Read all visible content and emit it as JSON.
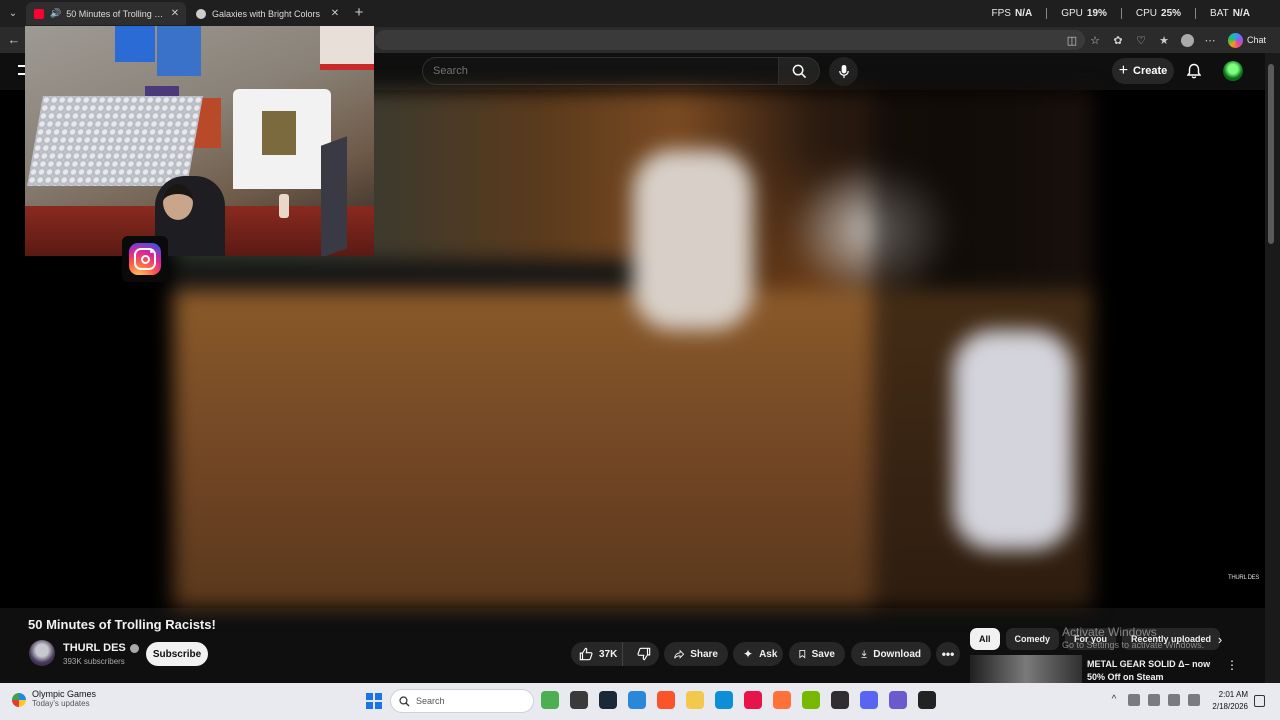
{
  "browser": {
    "tabs": [
      {
        "title": "50 Minutes of Trolling Racists!",
        "active": true,
        "favicon_color": "#ff0033"
      },
      {
        "title": "Galaxies with Bright Colors",
        "active": false,
        "favicon_color": "#cccccc"
      }
    ],
    "tab_close_glyph": "✕",
    "new_tab_glyph": "+",
    "back_glyph": "←",
    "chat_label": "Chat",
    "toolbar_icons": [
      "split-screen-icon",
      "favorite-star-icon",
      "extensions-icon",
      "performance-icon",
      "favorites-icon",
      "profile-icon",
      "more-icon"
    ]
  },
  "performance_overlay": {
    "fps": {
      "label": "FPS",
      "value": "N/A"
    },
    "gpu": {
      "label": "GPU",
      "value": "19%"
    },
    "cpu": {
      "label": "CPU",
      "value": "25%"
    },
    "bat": {
      "label": "BAT",
      "value": "N/A"
    }
  },
  "youtube": {
    "search_placeholder": "Search",
    "create_label": "Create",
    "video": {
      "title": "50 Minutes of Trolling Racists!",
      "channel_name": "THURL DES",
      "subscribers": "393K subscribers",
      "subscribe_label": "Subscribe",
      "watermark": "THURL DES",
      "likes": "37K",
      "share_label": "Share",
      "ask_label": "Ask",
      "save_label": "Save",
      "download_label": "Download",
      "more_glyph": "•••"
    },
    "chips": [
      "All",
      "Comedy",
      "For you",
      "Recently uploaded"
    ],
    "chip_next_glyph": "›",
    "recommendation": {
      "title": "METAL GEAR SOLID Δ– now 50% Off on Steam",
      "more_glyph": "⋮"
    }
  },
  "activate_windows": {
    "line1": "Activate Windows",
    "line2": "Go to Settings to activate Windows."
  },
  "taskbar": {
    "weather_title": "Olympic Games",
    "weather_sub": "Today's updates",
    "search_label": "Search",
    "apps": [
      {
        "name": "widgets-app",
        "color": "#4caf50"
      },
      {
        "name": "task-view-app",
        "color": "#3a3a3a"
      },
      {
        "name": "steam-app",
        "color": "#1b2838"
      },
      {
        "name": "notepad-app",
        "color": "#2b88d8"
      },
      {
        "name": "brave-app",
        "color": "#fb542b"
      },
      {
        "name": "file-explorer-app",
        "color": "#f2c94c"
      },
      {
        "name": "edge-app",
        "color": "#0c8fd6"
      },
      {
        "name": "tiktok-app",
        "color": "#e8134b"
      },
      {
        "name": "firefox-app",
        "color": "#ff7139"
      },
      {
        "name": "nvidia-app",
        "color": "#76b900"
      },
      {
        "name": "obs-app",
        "color": "#302e31"
      },
      {
        "name": "discord-app",
        "color": "#5865f2"
      },
      {
        "name": "calculator-app",
        "color": "#6a5acd"
      },
      {
        "name": "obs-studio-app",
        "color": "#222222"
      }
    ],
    "time": "2:01 AM",
    "date": "2/18/2026"
  }
}
